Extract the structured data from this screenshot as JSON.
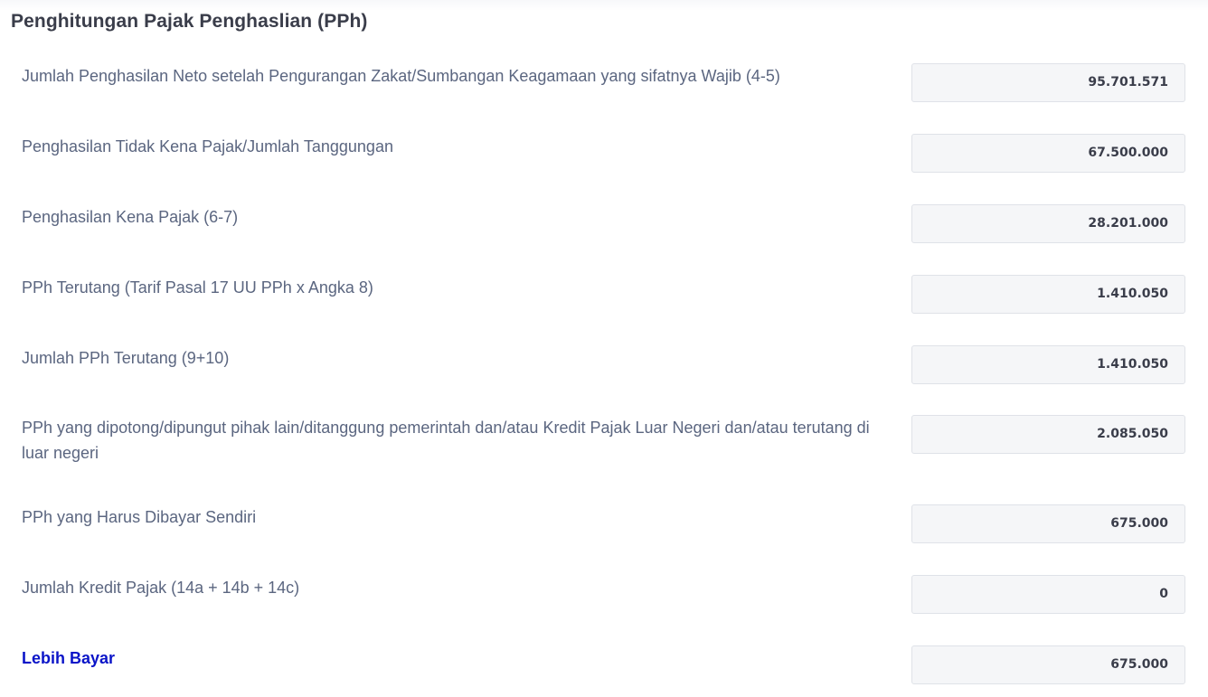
{
  "section": {
    "title": "Penghitungan Pajak Penghaslian (PPh)"
  },
  "rows": [
    {
      "label": "Jumlah Penghasilan Neto setelah Pengurangan Zakat/Sumbangan Keagamaan yang sifatnya Wajib (4-5)",
      "value": "95.701.571"
    },
    {
      "label": "Penghasilan Tidak Kena Pajak/Jumlah Tanggungan",
      "value": "67.500.000"
    },
    {
      "label": "Penghasilan Kena Pajak (6-7)",
      "value": "28.201.000"
    },
    {
      "label": "PPh Terutang (Tarif Pasal 17 UU PPh x Angka 8)",
      "value": "1.410.050"
    },
    {
      "label": "Jumlah PPh Terutang (9+10)",
      "value": "1.410.050"
    },
    {
      "label": "PPh yang dipotong/dipungut pihak lain/ditanggung pemerintah dan/atau Kredit Pajak Luar Negeri dan/atau terutang di luar negeri",
      "value": "2.085.050"
    },
    {
      "label": "PPh yang Harus Dibayar Sendiri",
      "value": "675.000"
    },
    {
      "label": "Jumlah Kredit Pajak (14a + 14b + 14c)",
      "value": "0"
    },
    {
      "label": "Lebih Bayar",
      "value": "675.000"
    }
  ],
  "colors": {
    "label": "#5b6680",
    "highlight_label": "#0a14c8",
    "field_background": "#f5f6f8",
    "field_border": "#dfe2e8"
  }
}
